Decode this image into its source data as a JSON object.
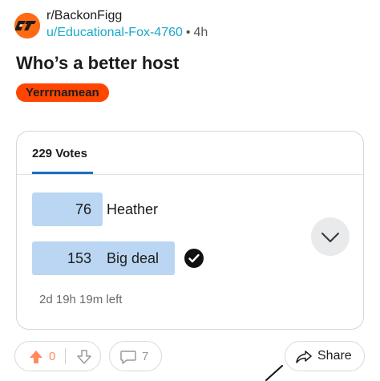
{
  "post": {
    "subreddit": "r/BackonFigg",
    "username": "u/Educational-Fox-4760",
    "separator": "•",
    "age": "4h",
    "title": "Who’s a better host",
    "flair": "Yerrrnamean"
  },
  "poll": {
    "votes_label": "229 Votes",
    "options": [
      {
        "count": "76",
        "label": "Heather",
        "fraction": 0.332,
        "selected": false
      },
      {
        "count": "153",
        "label": "Big deal",
        "fraction": 0.668,
        "selected": true
      }
    ],
    "time_left": "2d 19h 19m left"
  },
  "actions": {
    "score": "0",
    "comments": "7",
    "share_label": "Share"
  },
  "colors": {
    "flair_bg": "#ff4500",
    "bar_fill": "#bad6f2",
    "username": "#1aa9c7",
    "upvote_tint": "#ff8a5c",
    "tab_underline": "#1a6fc2"
  }
}
